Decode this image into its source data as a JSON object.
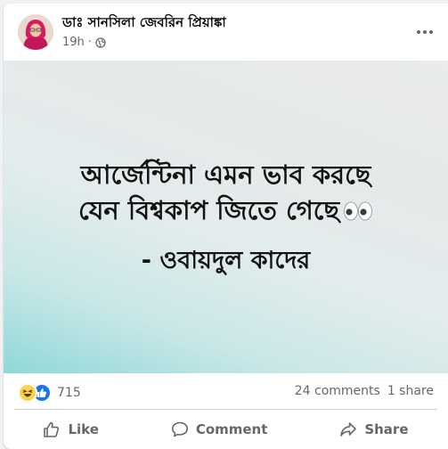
{
  "post": {
    "author": "ডাঃ সানসিলা জেবরিন প্রিয়াঙ্কা",
    "time": "19h",
    "separator": "·",
    "privacy_icon": "globe-icon"
  },
  "image": {
    "quote_line1": "আর্জেন্টিনা এমন ভাব করছে",
    "quote_line2": "যেন বিশ্বকাপ জিতে গেছে",
    "emoji": "eyes-emoji",
    "attribution": "- ওবায়দুল কাদের"
  },
  "stats": {
    "reaction_count": "715",
    "comments": "24 comments",
    "shares": "1 share"
  },
  "actions": {
    "like": "Like",
    "comment": "Comment",
    "share": "Share"
  },
  "colors": {
    "secondary_text": "#65676b",
    "like_blue": "#1b74e4",
    "haha_yellow": "#fcd34d"
  }
}
